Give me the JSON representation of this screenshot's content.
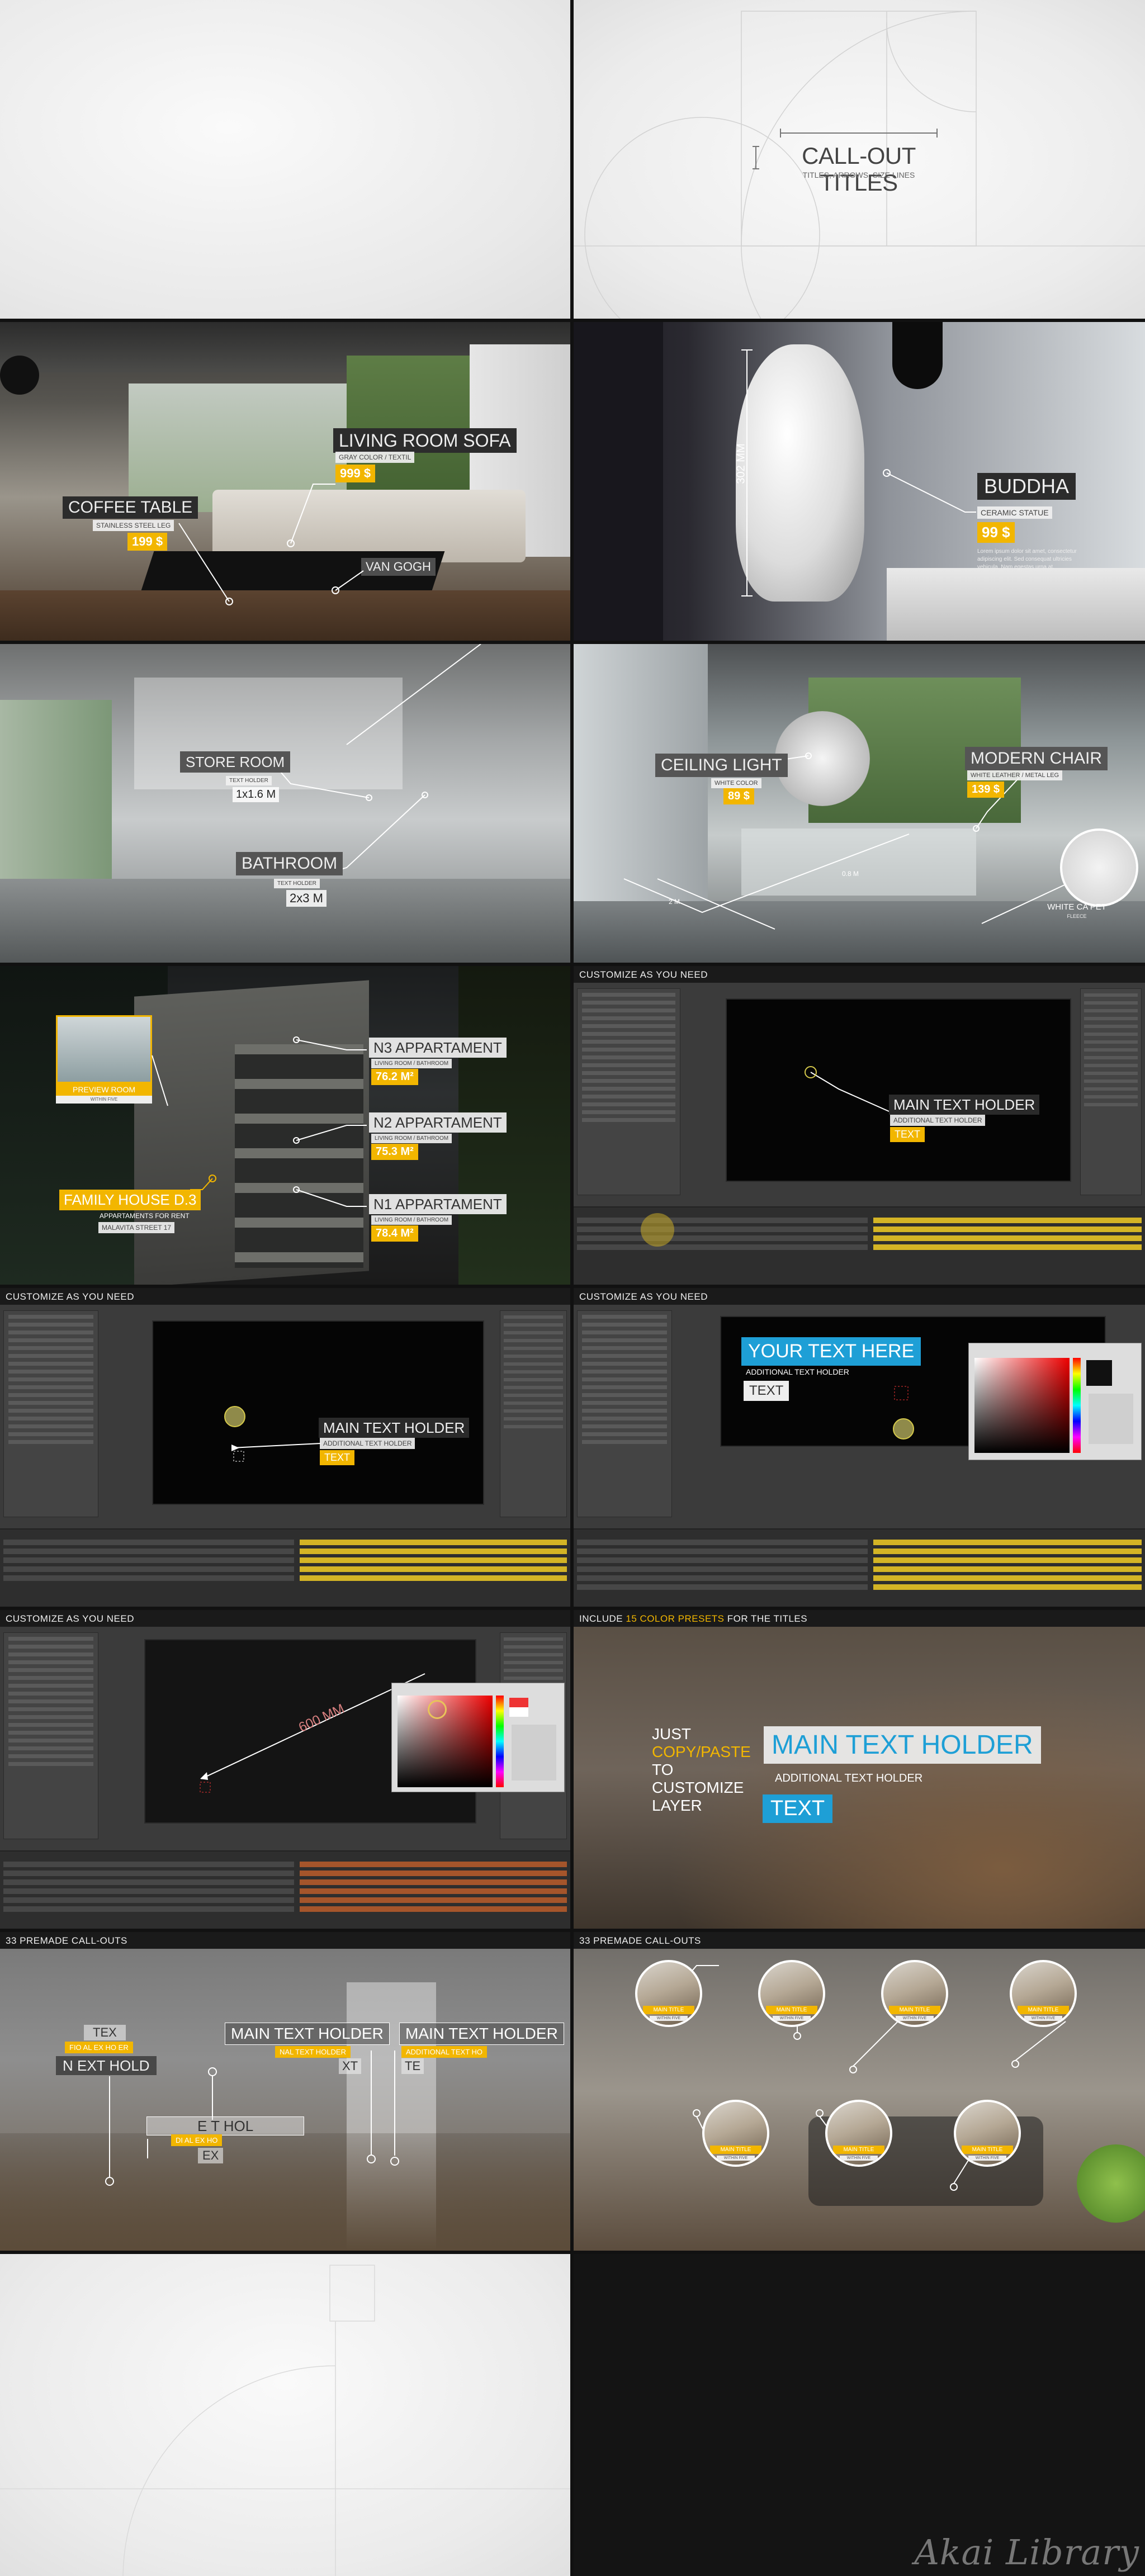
{
  "panel_callout": {
    "title": "CALL-OUT TITLES",
    "subtitle": "TITLES, ARROWS, SIZE LINES"
  },
  "panel_living": {
    "sofa": {
      "title": "LIVING ROOM SOFA",
      "sub": "GRAY COLOR / TEXTIL",
      "price": "999 $"
    },
    "table": {
      "title": "COFFEE TABLE",
      "sub": "STAINLESS STEEL LEG",
      "price": "199 $"
    },
    "book": {
      "title": "VAN GOGH"
    }
  },
  "panel_buddha": {
    "title": "BUDDHA",
    "sub": "CERAMIC STATUE",
    "price": "99 $",
    "size": "302 MM",
    "desc": "Lorem ipsum dolor sit amet, consectetur adipiscing elit. Sed consequat ultricies vehicula. Nam egestas urna at."
  },
  "panel_bath": {
    "store": {
      "title": "STORE ROOM",
      "sub": "TEXT HOLDER",
      "size": "1x1.6 M"
    },
    "bath": {
      "title": "BATHROOM",
      "sub": "TEXT HOLDER",
      "size": "2x3 M"
    }
  },
  "panel_dining": {
    "light": {
      "title": "CEILING LIGHT",
      "sub": "WHITE COLOR",
      "price": "89 $"
    },
    "chair": {
      "title": "MODERN CHAIR",
      "sub": "WHITE LEATHER / METAL LEG",
      "price": "139 $"
    },
    "carpet": {
      "title": "WHITE CA PET",
      "sub": "FLEECE"
    },
    "dim1": "2 M",
    "dim2": "0.8 M"
  },
  "panel_building": {
    "preview": {
      "title": "PREVIEW ROOM",
      "sub": "WITHIN FIVE"
    },
    "house": {
      "title": "FAMILY HOUSE D.3",
      "sub1": "APPARTAMENTS FOR RENT",
      "sub2": "MALAVITA STREET 17"
    },
    "n3": {
      "title": "N3 APPARTAMENT",
      "sub": "LIVING ROOM / BATHROOM",
      "area": "76.2 M²"
    },
    "n2": {
      "title": "N2 APPARTAMENT",
      "sub": "LIVING ROOM / BATHROOM",
      "area": "75.3 M²"
    },
    "n1": {
      "title": "N1 APPARTAMENT",
      "sub": "LIVING ROOM / BATHROOM",
      "area": "78.4 M²"
    }
  },
  "panel_ae1": {
    "header": "CUSTOMIZE AS YOU NEED",
    "main": "MAIN TEXT HOLDER",
    "additional": "ADDITIONAL TEXT HOLDER",
    "text": "TEXT"
  },
  "panel_ae2": {
    "header": "CUSTOMIZE AS YOU NEED",
    "main": "MAIN TEXT HOLDER",
    "additional": "ADDITIONAL TEXT HOLDER",
    "text": "TEXT"
  },
  "panel_ae3": {
    "header": "CUSTOMIZE AS YOU NEED",
    "main": "YOUR TEXT HERE",
    "additional": "ADDITIONAL TEXT HOLDER",
    "text": "TEXT"
  },
  "panel_ae4": {
    "header": "CUSTOMIZE AS YOU NEED",
    "size": "600 MM"
  },
  "panel_presets": {
    "header_pre": "INCLUDE ",
    "header_hl": "15 COLOR PRESETS",
    "header_post": " FOR THE TITLES",
    "just": "JUST",
    "copy": "COPY/PASTE",
    "to": "TO",
    "customize": "CUSTOMIZE",
    "layer": "LAYER",
    "main": "MAIN TEXT HOLDER",
    "additional": "ADDITIONAL TEXT HOLDER",
    "text": "TEXT"
  },
  "panel_premade1": {
    "header": "33 PREMADE CALL-OUTS",
    "a_top": "TEX",
    "a_mid": "FIO AL EX HO ER",
    "a_bot": "N EXT HOLD",
    "b_main": "MAIN TEXT HOLDER",
    "b_sub": "NAL TEXT HOLDER",
    "b_txt": "XT",
    "c_main": "MAIN TEXT HOLDER",
    "c_sub": "ADDITIONAL TEXT HO",
    "c_txt": "TE",
    "d_top": "E T HOL",
    "d_mid": "DI AL EX HO",
    "d_bot": "EX"
  },
  "panel_premade2": {
    "header": "33 PREMADE CALL-OUTS",
    "thumb_title": "MAIN TITLE",
    "thumb_sub": "WITHIN FIVE"
  },
  "watermark": "Akai Library",
  "colors": {
    "accent": "#f2b600",
    "blue": "#1e9fd6",
    "header": "#1a1a1a"
  }
}
